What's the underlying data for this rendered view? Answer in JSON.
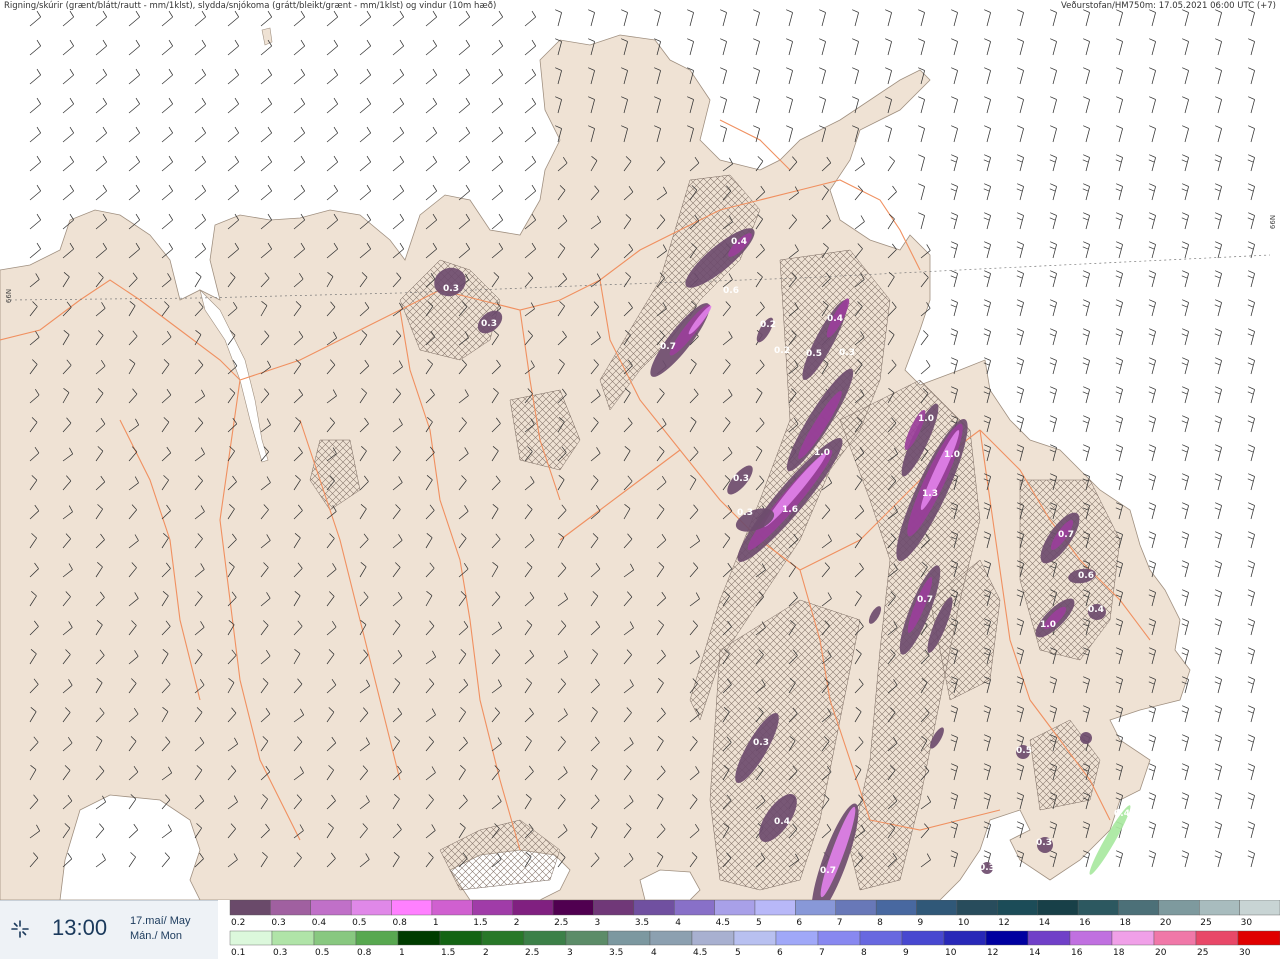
{
  "header": {
    "left_text": "Rigning/skúrir (grænt/blátt/rautt - mm/1klst), slydda/snjókoma (grátt/bleikt/grænt - mm/1klst) og vindur (10m hæð)",
    "right_text": "Veðurstofan/HM750m: 17.05.2021 06:00 UTC (+7)"
  },
  "map": {
    "lat_label_left": "66N",
    "lat_label_right": "66N",
    "colors": {
      "land": "#efe2d4",
      "sea": "#ffffff",
      "roads": "#f0a070",
      "wind_barbs": "#333333",
      "snow_light": "#6e4c6e",
      "snow_mid": "#9a3f9a",
      "snow_heavy": "#e080e8",
      "rain_green": "#a8e8a0"
    },
    "precip_labels": [
      {
        "text": "0.3"
      },
      {
        "text": "0.3"
      },
      {
        "text": "0.4"
      },
      {
        "text": "0.6"
      },
      {
        "text": "0.7"
      },
      {
        "text": "0.2"
      },
      {
        "text": "0.2"
      },
      {
        "text": "0.4"
      },
      {
        "text": "0.5"
      },
      {
        "text": "0.3"
      },
      {
        "text": "1.0"
      },
      {
        "text": "0.3"
      },
      {
        "text": "0.3"
      },
      {
        "text": "1.6"
      },
      {
        "text": "1.0"
      },
      {
        "text": "1.0"
      },
      {
        "text": "1.3"
      },
      {
        "text": "0.7"
      },
      {
        "text": "0.6"
      },
      {
        "text": "0.4"
      },
      {
        "text": "1.0"
      },
      {
        "text": "0.7"
      },
      {
        "text": "0.3"
      },
      {
        "text": "0.4"
      },
      {
        "text": "0.7"
      },
      {
        "text": "0.5"
      },
      {
        "text": "0.3"
      },
      {
        "text": "0.3"
      },
      {
        "text": "0.4"
      }
    ]
  },
  "info": {
    "time": "13:00",
    "date_line1": "17.maí/ May",
    "date_line2": "Mán./ Mon",
    "icon": "sun-icon"
  },
  "legend": {
    "snow_values": [
      "0.2",
      "0.3",
      "0.4",
      "0.5",
      "0.8",
      "1",
      "1.5",
      "2",
      "2.5",
      "3",
      "3.5",
      "4",
      "4.5",
      "5",
      "6",
      "7",
      "8",
      "9",
      "10",
      "12",
      "14",
      "16",
      "18",
      "20",
      "25",
      "30"
    ],
    "snow_colors": [
      "#6a4a6a",
      "#a060a0",
      "#c070c8",
      "#e088e8",
      "#ff80ff",
      "#d060d0",
      "#a03ca8",
      "#802080",
      "#500050",
      "#703878",
      "#7050a0",
      "#8870c8",
      "#a8a0e8",
      "#b8b8f8",
      "#8898d8",
      "#6878b8",
      "#4868a0",
      "#305878",
      "#284c5c",
      "#1c4c58",
      "#184048",
      "#2c5860",
      "#4c7078",
      "#7e9a9e",
      "#a8bcbe",
      "#c8d4d4"
    ],
    "rain_values": [
      "0.1",
      "0.3",
      "0.5",
      "0.8",
      "1",
      "1.5",
      "2",
      "2.5",
      "3",
      "3.5",
      "4",
      "4.5",
      "5",
      "6",
      "7",
      "8",
      "9",
      "10",
      "12",
      "14",
      "16",
      "18",
      "20",
      "25",
      "30"
    ],
    "rain_colors": [
      "#dcf8dc",
      "#b0e4a8",
      "#88c880",
      "#58a850",
      "#003c00",
      "#146414",
      "#287828",
      "#3c8048",
      "#5c8c68",
      "#7c98a0",
      "#8ca0b0",
      "#a8b0d0",
      "#b8c0f0",
      "#a0a8f8",
      "#8888f0",
      "#6868e0",
      "#4848d0",
      "#2828b8",
      "#0000a0",
      "#7040c8",
      "#c070e0",
      "#f0a0e8",
      "#f078a8",
      "#e84868",
      "#e00000"
    ]
  }
}
